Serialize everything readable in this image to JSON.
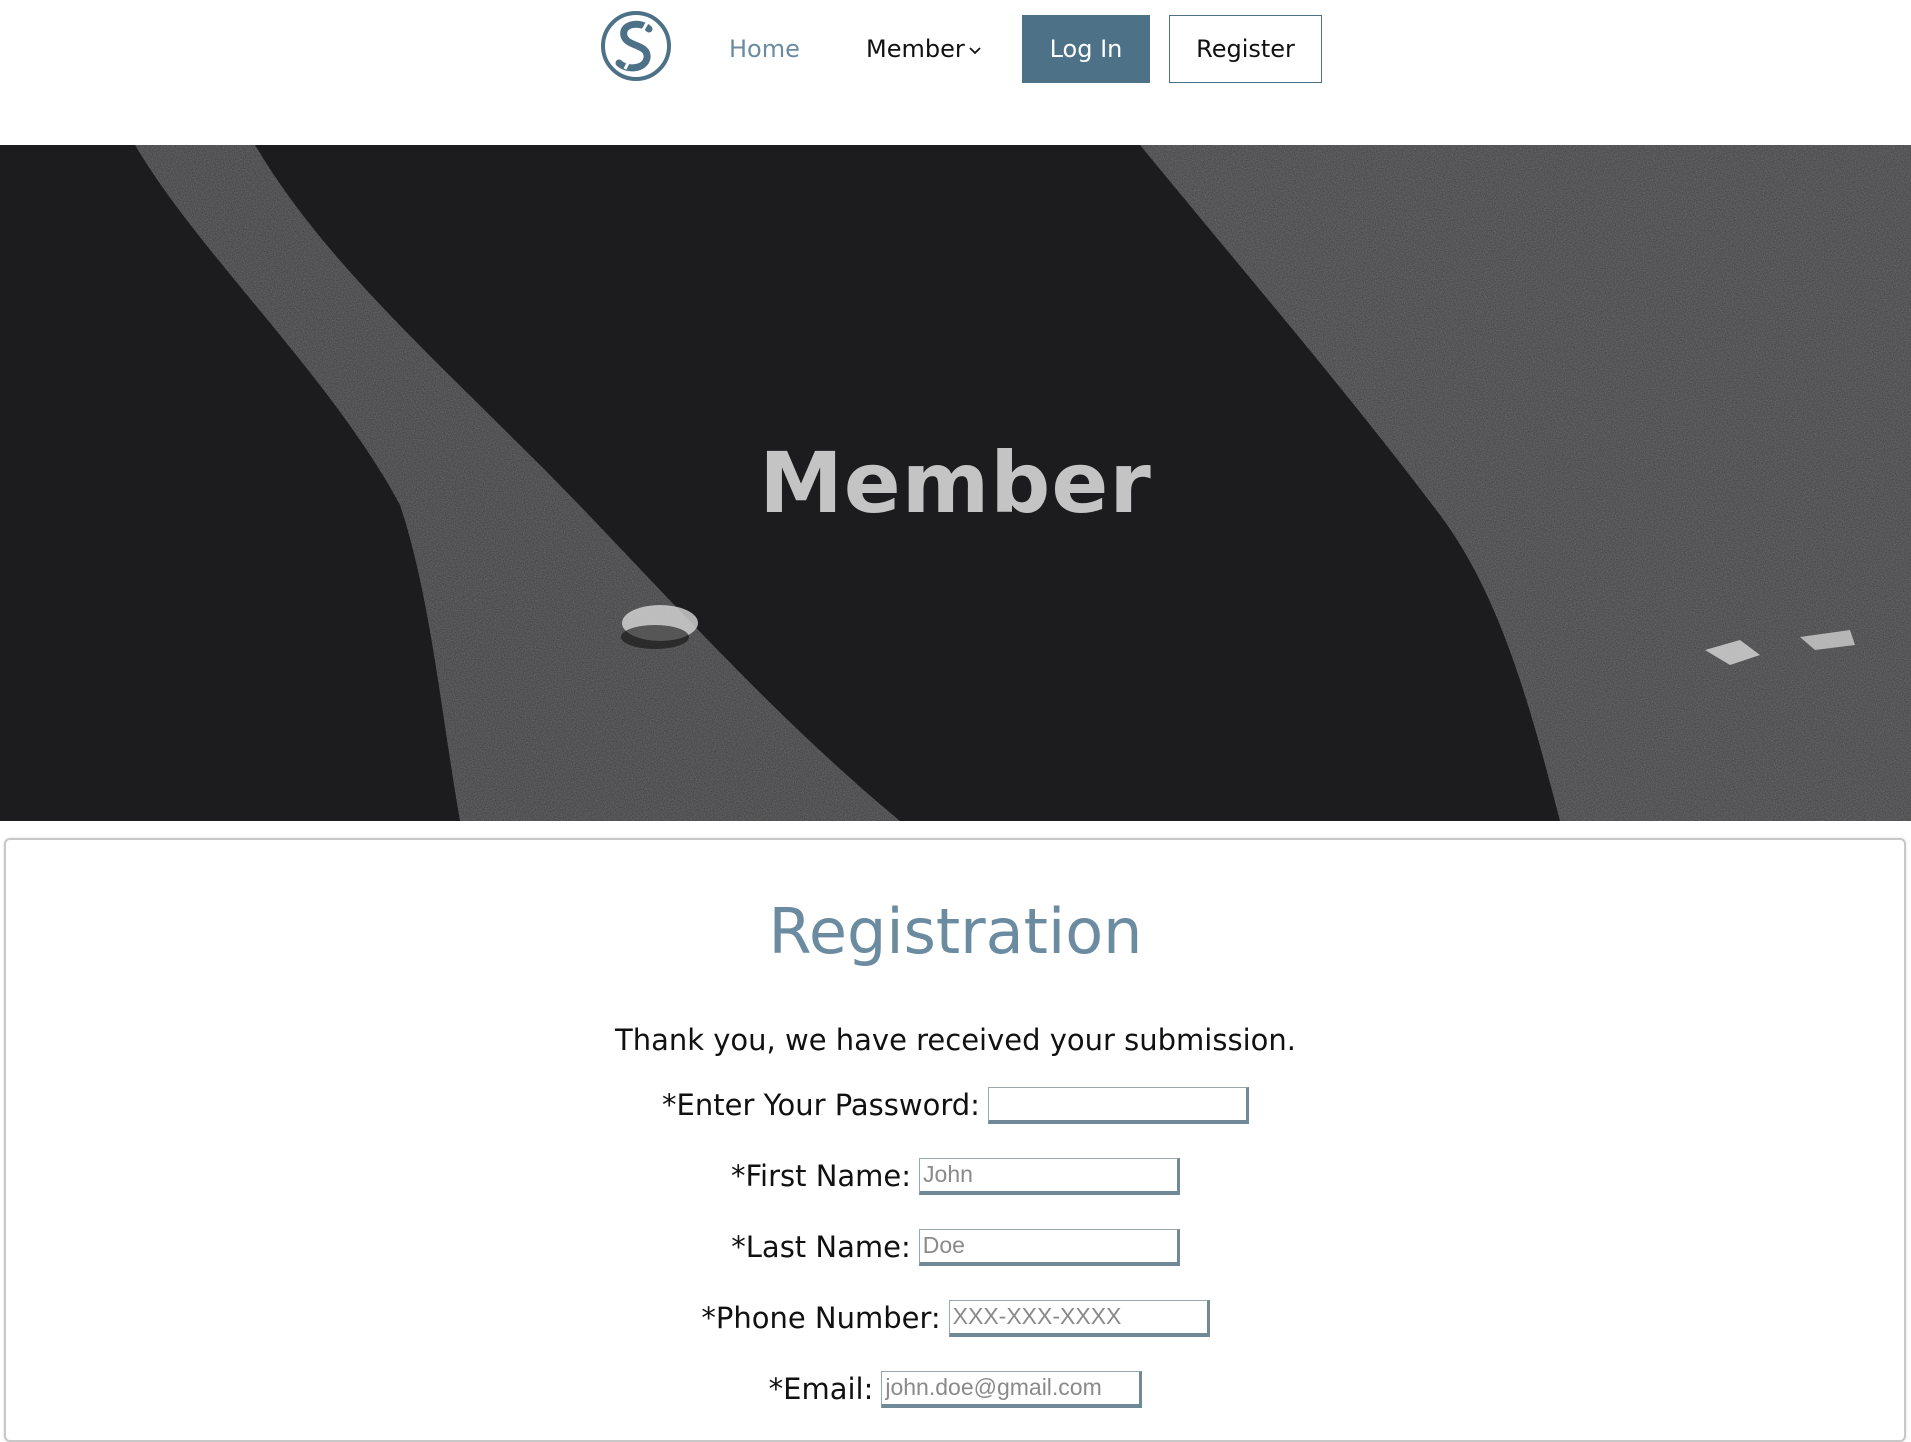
{
  "nav": {
    "logo_letter": "S",
    "home": "Home",
    "member": "Member",
    "login": "Log In",
    "register": "Register"
  },
  "hero": {
    "title": "Member"
  },
  "form": {
    "title": "Registration",
    "message": "Thank you, we have received your submission.",
    "fields": [
      {
        "label": "*Enter Your Password:",
        "placeholder": ""
      },
      {
        "label": "*First Name:",
        "placeholder": "John"
      },
      {
        "label": "*Last Name:",
        "placeholder": "Doe"
      },
      {
        "label": "*Phone Number:",
        "placeholder": "XXX-XXX-XXXX"
      },
      {
        "label": "*Email:",
        "placeholder": "john.doe@gmail.com"
      }
    ]
  },
  "colors": {
    "accent": "#4d7187",
    "heading": "#6b8ba0",
    "hero_bg": "#1c1c1e"
  }
}
